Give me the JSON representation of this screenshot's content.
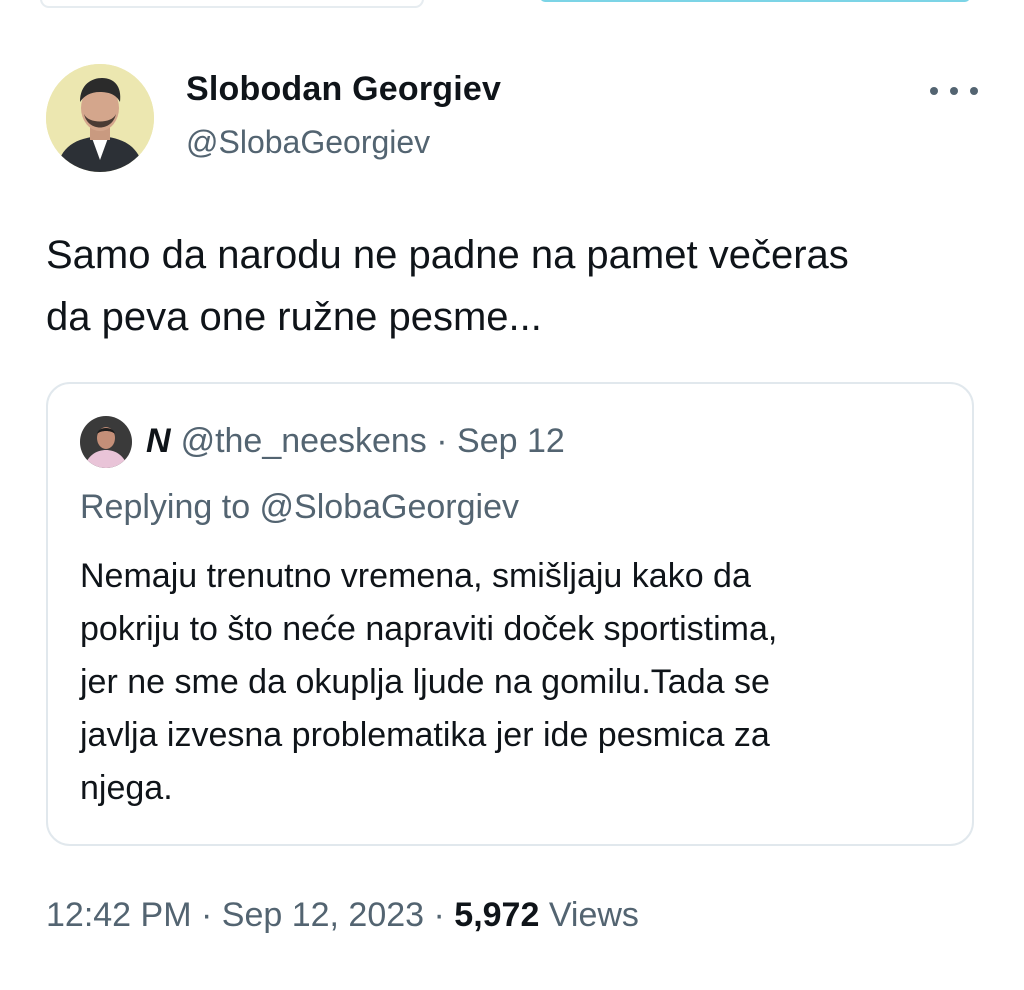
{
  "author": {
    "name": "Slobodan Georgiev",
    "handle": "@SlobaGeorgiev",
    "avatar": "person-avatar"
  },
  "more_icon": "ellipsis-horizontal-icon",
  "tweet": {
    "lines": [
      "Samo da narodu ne padne na pamet večeras",
      "da peva one ružne pesme..."
    ]
  },
  "quote": {
    "name": "N",
    "handle": "@the_neeskens",
    "separator": "·",
    "date": "Sep 12",
    "replying_to": "Replying to @SlobaGeorgiev",
    "lines": [
      "Nemaju trenutno vremena, smišljaju kako da",
      "pokriju to što neće napraviti doček sportistima,",
      "jer ne sme da okuplja ljude na gomilu.Tada se",
      "javlja izvesna problematika jer ide pesmica za",
      "njega."
    ]
  },
  "meta": {
    "time": "12:42 PM",
    "separator": "·",
    "date": "Sep 12, 2023",
    "views_count": "5,972",
    "views_label": "Views"
  },
  "colors": {
    "text": "#0f1419",
    "secondary": "#536471",
    "border": "#e1e8ed"
  }
}
